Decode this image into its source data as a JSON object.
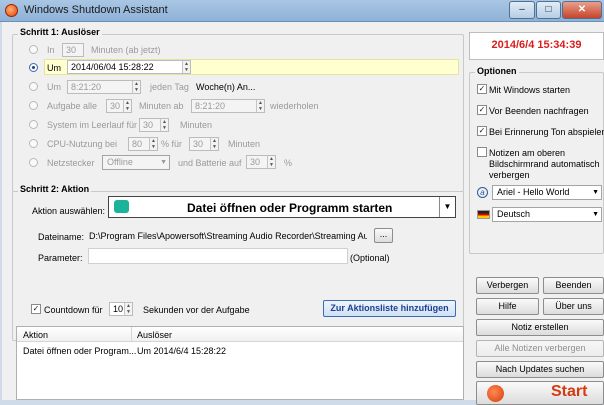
{
  "window": {
    "title": "Windows Shutdown Assistant",
    "minimize": "‒",
    "maximize": "□",
    "close": "✕"
  },
  "step1": {
    "title": "Schritt 1: Auslöser",
    "in_label": "In",
    "in_value": "30",
    "in_unit": "Minuten (ab jetzt)",
    "um_label": "Um",
    "um_value": "2014/06/04  15:28:22",
    "daily_label": "Um",
    "daily_value": "8:21:20",
    "daily_mid": "jeden Tag",
    "daily_link": "Woche(n) An...",
    "task_label": "Aufgabe alle",
    "task_value": "30",
    "task_mid": "Minuten ab",
    "task_time": "8:21:20",
    "task_end": "wiederholen",
    "idle_label": "System im Leerlauf für",
    "idle_value": "30",
    "idle_unit": "Minuten",
    "cpu_label": "CPU-Nutzung bei",
    "cpu_value": "80",
    "cpu_mid": "% für",
    "cpu_time": "30",
    "cpu_unit": "Minuten",
    "plug_label": "Netzstecker",
    "plug_value": "Offline",
    "plug_mid": "und Batterie auf",
    "plug_batt": "30",
    "plug_unit": "%"
  },
  "step2": {
    "title": "Schritt 2: Aktion",
    "action_label": "Aktion auswählen:",
    "action_value": "Datei öffnen oder Programm starten",
    "file_label": "Dateiname:",
    "file_value": "D:\\Program Files\\Apowersoft\\Streaming Audio Recorder\\Streaming Audio",
    "browse": "...",
    "param_label": "Parameter:",
    "param_value": "",
    "param_optional": "(Optional)",
    "countdown_label": "Countdown für",
    "countdown_value": "10",
    "countdown_text": "Sekunden vor der Aufgabe",
    "add_button": "Zur Aktionsliste hinzufügen"
  },
  "table": {
    "headers": [
      "Aktion",
      "Auslöser"
    ],
    "rows": [
      [
        "Datei öffnen oder Program...",
        "Um 2014/6/4 15:28:22"
      ]
    ]
  },
  "clock": {
    "value": "2014/6/4 15:34:39",
    "color": "#d81e1e"
  },
  "options": {
    "title": "Optionen",
    "items": [
      {
        "label": "Mit Windows starten",
        "checked": true
      },
      {
        "label": "Vor Beenden nachfragen",
        "checked": true
      },
      {
        "label": "Bei Erinnerung Ton abspielen",
        "checked": true
      },
      {
        "label": "Notizen am oberen Bildschirmrand automatisch verbergen",
        "checked": false
      }
    ],
    "font_value": "Ariel  - Hello World",
    "language_value": "Deutsch"
  },
  "buttons": {
    "hide": "Verbergen",
    "exit": "Beenden",
    "help": "Hilfe",
    "about": "Über uns",
    "note": "Notiz erstellen",
    "hide_notes": "Alle Notizen verbergen",
    "updates": "Nach Updates suchen",
    "start": "Start"
  },
  "colors": {
    "start_text": "#d63a10",
    "add_button_text": "#1f3f8f",
    "highlight": "#ffffd0"
  }
}
